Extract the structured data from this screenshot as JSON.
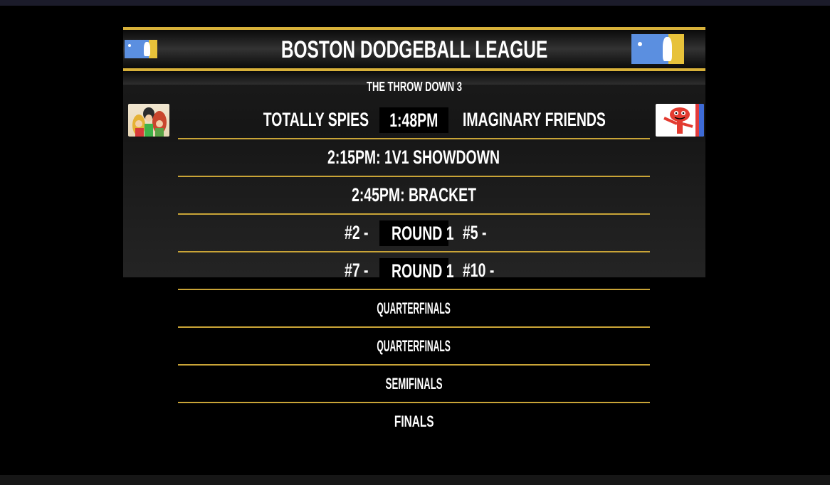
{
  "league": {
    "title": "BOSTON DODGEBALL LEAGUE",
    "event": "THE THROW DOWN 3"
  },
  "colors": {
    "gold": "#d8b13a",
    "logo_blue": "#5b8fe0",
    "logo_gold": "#e7c23a"
  },
  "current_match": {
    "team_a": "TOTALLY SPIES",
    "time": "1:48PM",
    "team_b": "IMAGINARY FRIENDS"
  },
  "schedule": [
    {
      "label": "2:15PM: 1V1 SHOWDOWN"
    },
    {
      "label": "2:45PM: BRACKET"
    }
  ],
  "bracket": [
    {
      "left": "#2 -",
      "round": "ROUND 1",
      "right": "#5 -"
    },
    {
      "left": "#7 -",
      "round": "ROUND 1",
      "right": "#10 -"
    }
  ],
  "stages": [
    {
      "label": "QUARTERFINALS"
    },
    {
      "label": "QUARTERFINALS"
    },
    {
      "label": "SEMIFINALS"
    },
    {
      "label": "FINALS"
    }
  ]
}
